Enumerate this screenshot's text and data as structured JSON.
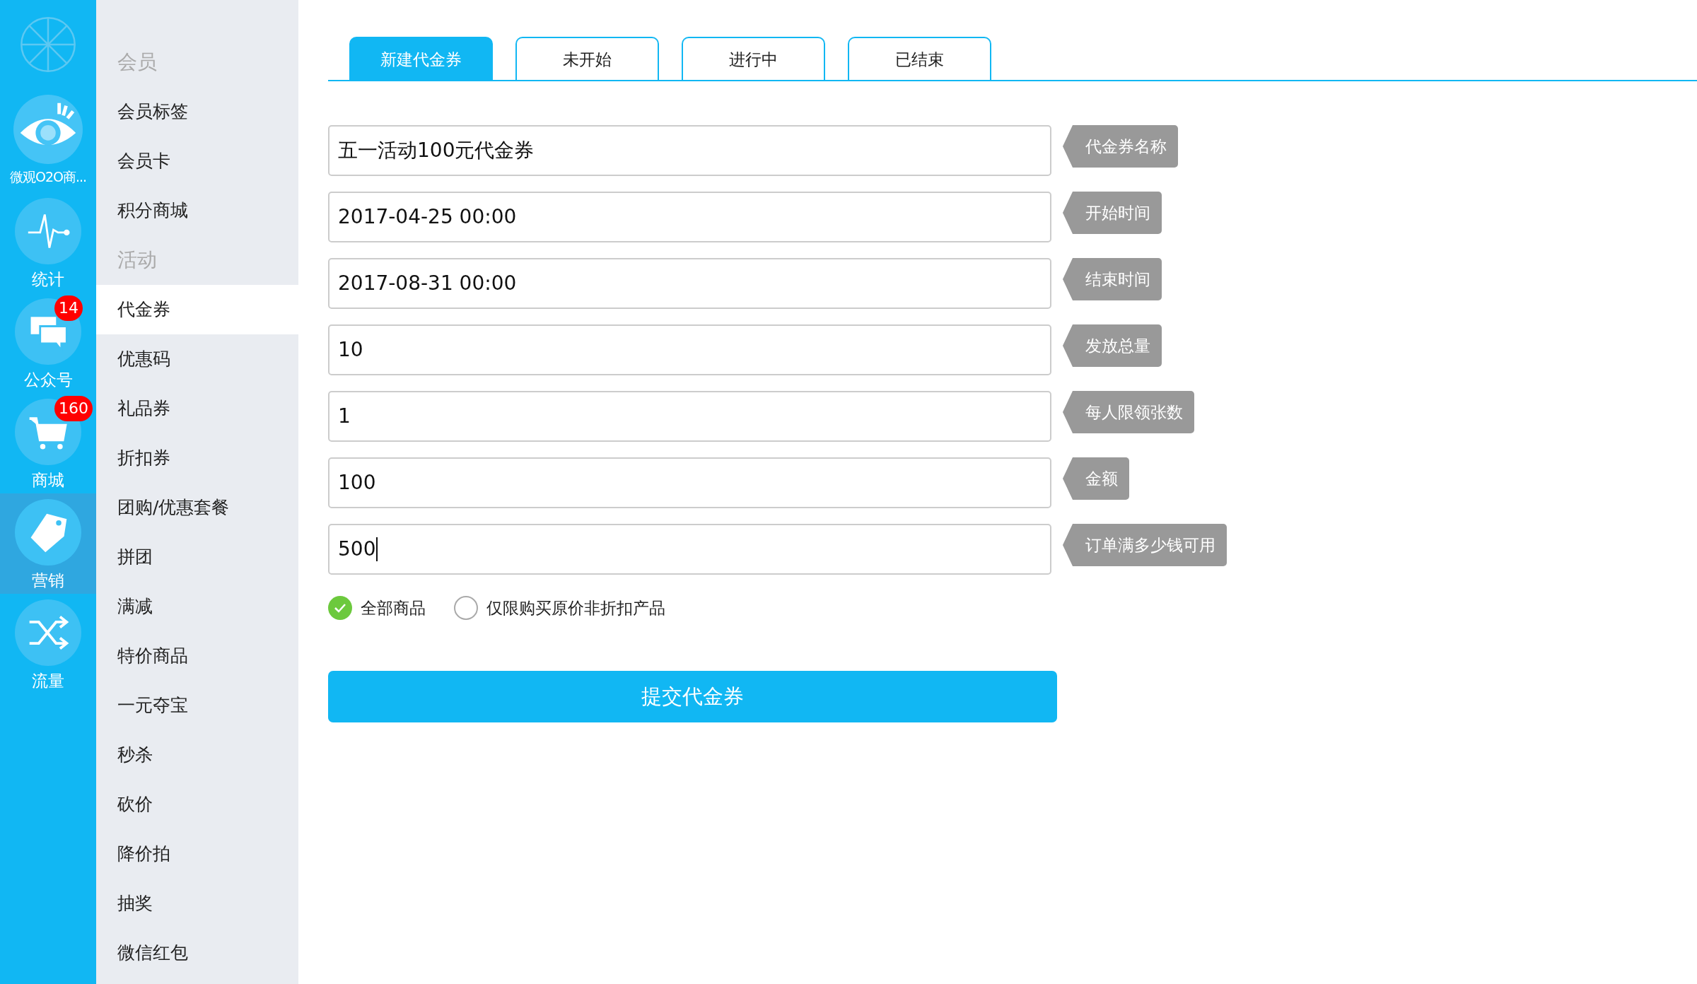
{
  "nav": {
    "app": {
      "label": "微观O2O商..."
    },
    "items": [
      {
        "label": "统计",
        "selected": false
      },
      {
        "label": "公众号",
        "badge": "14",
        "selected": false
      },
      {
        "label": "商城",
        "badge": "160",
        "selected": false
      },
      {
        "label": "营销",
        "selected": true
      },
      {
        "label": "流量",
        "selected": false
      }
    ]
  },
  "sidebar": {
    "items": [
      {
        "kind": "header",
        "label": "会员"
      },
      {
        "kind": "link",
        "label": "会员标签",
        "selected": false
      },
      {
        "kind": "link",
        "label": "会员卡",
        "selected": false
      },
      {
        "kind": "link",
        "label": "积分商城",
        "selected": false
      },
      {
        "kind": "header",
        "label": "活动"
      },
      {
        "kind": "link",
        "label": "代金券",
        "selected": true
      },
      {
        "kind": "link",
        "label": "优惠码",
        "selected": false
      },
      {
        "kind": "link",
        "label": "礼品券",
        "selected": false
      },
      {
        "kind": "link",
        "label": "折扣券",
        "selected": false
      },
      {
        "kind": "link",
        "label": "团购/优惠套餐",
        "selected": false
      },
      {
        "kind": "link",
        "label": "拼团",
        "selected": false
      },
      {
        "kind": "link",
        "label": "满减",
        "selected": false
      },
      {
        "kind": "link",
        "label": "特价商品",
        "selected": false
      },
      {
        "kind": "link",
        "label": "一元夺宝",
        "selected": false
      },
      {
        "kind": "link",
        "label": "秒杀",
        "selected": false
      },
      {
        "kind": "link",
        "label": "砍价",
        "selected": false
      },
      {
        "kind": "link",
        "label": "降价拍",
        "selected": false
      },
      {
        "kind": "link",
        "label": "抽奖",
        "selected": false
      },
      {
        "kind": "link",
        "label": "微信红包",
        "selected": false
      }
    ]
  },
  "tabs": [
    {
      "label": "新建代金券",
      "selected": true
    },
    {
      "label": "未开始",
      "selected": false
    },
    {
      "label": "进行中",
      "selected": false
    },
    {
      "label": "已结束",
      "selected": false
    }
  ],
  "form": {
    "fields": [
      {
        "value": "五一活动100元代金券",
        "label": "代金券名称",
        "focused": false
      },
      {
        "value": "2017-04-25 00:00",
        "label": "开始时间",
        "focused": false
      },
      {
        "value": "2017-08-31 00:00",
        "label": "结束时间",
        "focused": false
      },
      {
        "value": "10",
        "label": "发放总量",
        "focused": false
      },
      {
        "value": "1",
        "label": "每人限领张数",
        "focused": false
      },
      {
        "value": "100",
        "label": "金额",
        "focused": false
      },
      {
        "value": "500",
        "label": "订单满多少钱可用",
        "focused": true
      }
    ],
    "scope": [
      {
        "label": "全部商品",
        "selected": true
      },
      {
        "label": "仅限购买原价非折扣产品",
        "selected": false
      }
    ],
    "submit": "提交代金券"
  }
}
